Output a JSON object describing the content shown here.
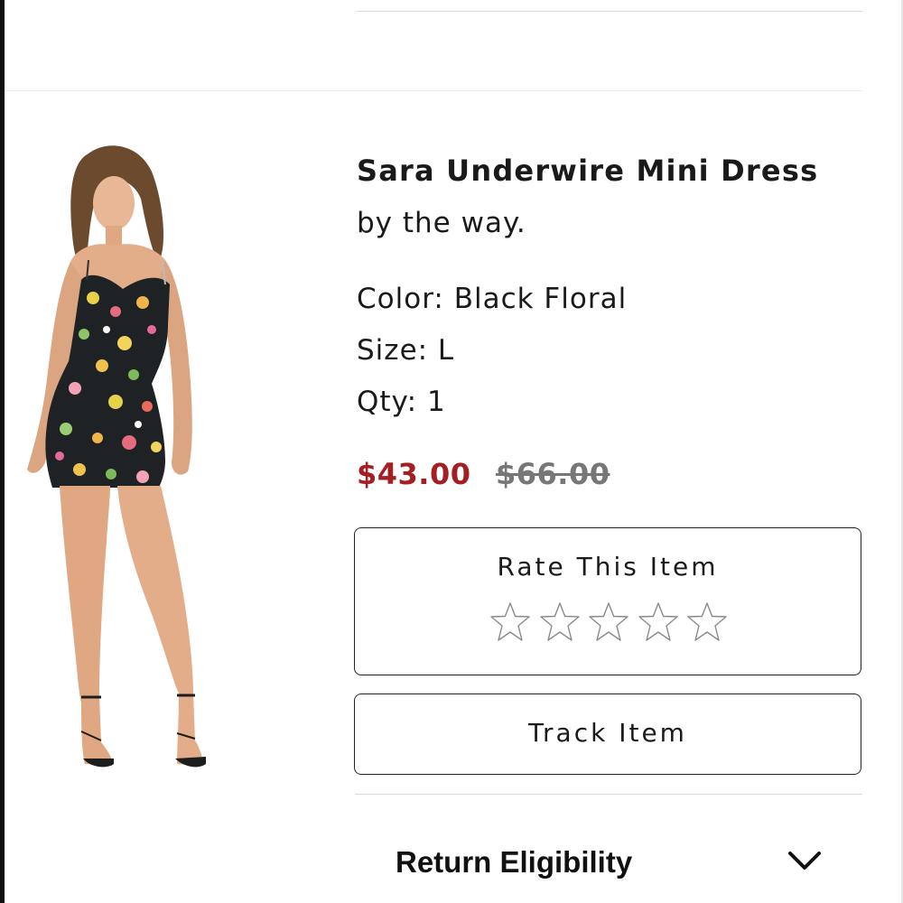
{
  "product": {
    "name": "Sara Underwire Mini Dress",
    "brand": "by the way.",
    "color_line": "Color: Black Floral",
    "size_line": "Size: L",
    "qty_line": "Qty: 1",
    "price_sale": "$43.00",
    "price_original": "$66.00",
    "photo_icon": "dress-photo"
  },
  "rating": {
    "title": "Rate This Item",
    "stars_total": 5,
    "stars_selected": 0,
    "star_icon": "star-outline-icon"
  },
  "actions": {
    "track_label": "Track Item"
  },
  "returns": {
    "label": "Return Eligibility",
    "expand_icon": "chevron-down-icon"
  },
  "colors": {
    "sale_price": "#a31f24",
    "original_price": "#777777",
    "border": "#222222"
  }
}
